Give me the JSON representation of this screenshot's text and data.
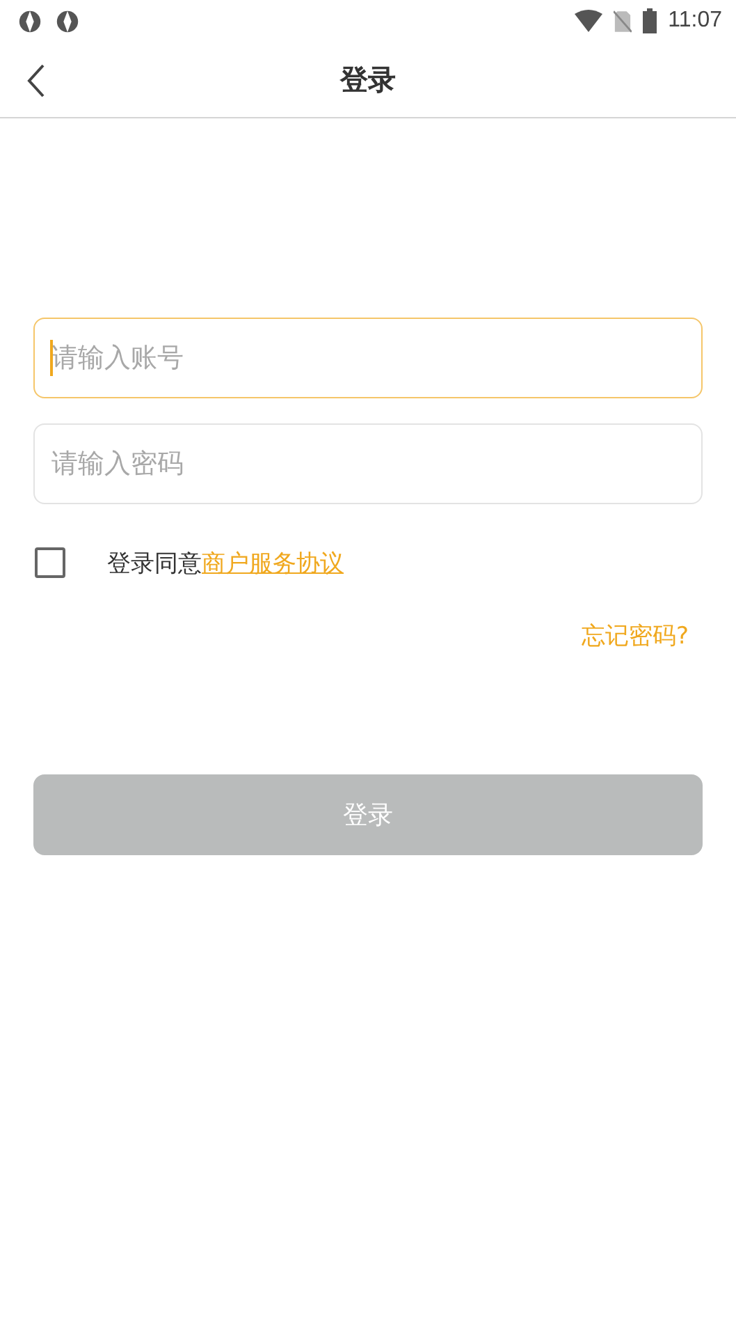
{
  "status_bar": {
    "time": "11:07"
  },
  "header": {
    "title": "登录"
  },
  "fields": [
    {
      "placeholder": "请输入账号",
      "focused": true
    },
    {
      "placeholder": "请输入密码",
      "focused": false
    }
  ],
  "agreement": {
    "checked": false,
    "text": "登录同意",
    "link": "商户服务协议"
  },
  "forgot_link": "忘记密码?",
  "login_button": {
    "label": "登录",
    "disabled": true
  }
}
